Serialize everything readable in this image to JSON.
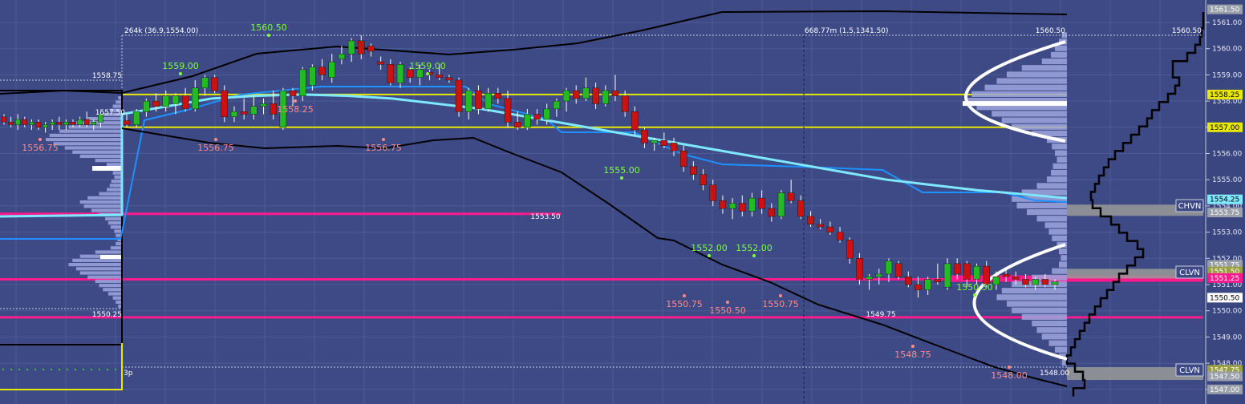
{
  "chart_data": {
    "type": "candlestick",
    "title": "",
    "xlabel": "",
    "ylabel": "",
    "ylim": [
      1547.0,
      1561.5
    ],
    "grid": true,
    "axis_ticks": [
      "1561.00",
      "1560.00",
      "1559.00",
      "1558.00",
      "1557.00",
      "1556.00",
      "1555.00",
      "1554.00",
      "1553.00",
      "1552.00",
      "1551.00",
      "1550.00",
      "1549.00",
      "1548.00",
      "1547.00"
    ],
    "header_labels": {
      "left": "264k (36.9,1554.00)",
      "middle": "668.77m (1.5,1341.50)",
      "right_high": "1560.50",
      "far_right_high": "1560.50",
      "prev_high": "1558.75",
      "prev_low": "1550.25",
      "prev_mid": "1557.50",
      "bottom_left": "3p",
      "session_low": "1548.00"
    },
    "axis_badges": [
      {
        "label": "1561.50",
        "value": 1561.5,
        "color": "#9aa0aa"
      },
      {
        "label": "1558.25",
        "value": 1558.25,
        "color": "#e8e800"
      },
      {
        "label": "1557.00",
        "value": 1557.0,
        "color": "#e8e800"
      },
      {
        "label": "1554.25",
        "value": 1554.25,
        "color": "#7ee8ff"
      },
      {
        "label": "1553.75",
        "value": 1553.75,
        "color": "#9aa0aa"
      },
      {
        "label": "1551.75",
        "value": 1551.75,
        "color": "#9aa0aa"
      },
      {
        "label": "1551.50",
        "value": 1551.5,
        "color": "#9aa040"
      },
      {
        "label": "1551.25",
        "value": 1551.25,
        "color": "#ff1a8c"
      },
      {
        "label": "1550.50",
        "value": 1550.5,
        "color": "#ffffff"
      },
      {
        "label": "1547.75",
        "value": 1547.75,
        "color": "#9aa040"
      },
      {
        "label": "1547.50",
        "value": 1547.5,
        "color": "#9aa0aa"
      },
      {
        "label": "1547.00",
        "value": 1547.0,
        "color": "#9aa0aa"
      }
    ],
    "level_tags": [
      {
        "label": "CHVN",
        "value": 1554.0
      },
      {
        "label": "CLVN",
        "value": 1551.25
      },
      {
        "label": "CLVN",
        "value": 1547.5
      }
    ],
    "horizontal_lines": [
      {
        "value": 1558.25,
        "color": "#e8e800"
      },
      {
        "value": 1557.0,
        "color": "#e8e800"
      },
      {
        "value": 1553.7,
        "color": "#ff1a8c"
      },
      {
        "value": 1551.2,
        "color": "#ff1a8c"
      },
      {
        "value": 1549.75,
        "color": "#ff1a8c"
      }
    ],
    "swing_highs": [
      {
        "label": "1560.50",
        "bar": 19
      },
      {
        "label": "1559.00",
        "bar": 13
      },
      {
        "label": "1559.00",
        "bar": 33
      },
      {
        "label": "1555.00",
        "bar": 47
      },
      {
        "label": "1552.00",
        "bar": 55
      },
      {
        "label": "1552.00",
        "bar": 59
      },
      {
        "label": "1550.50",
        "bar": 76
      }
    ],
    "swing_lows": [
      {
        "label": "1556.75",
        "bar": -5
      },
      {
        "label": "1558.25",
        "bar": 22
      },
      {
        "label": "1556.75",
        "bar": 16
      },
      {
        "label": "1556.75",
        "bar": 29
      },
      {
        "label": "1553.50",
        "bar": 43
      },
      {
        "label": "1550.75",
        "bar": 53
      },
      {
        "label": "1550.50",
        "bar": 57
      },
      {
        "label": "1550.75",
        "bar": 61
      },
      {
        "label": "1549.75",
        "bar": 69
      },
      {
        "label": "1548.75",
        "bar": 71
      },
      {
        "label": "1548.00",
        "bar": 79
      }
    ],
    "candles_prev": [
      [
        1557.4,
        1557.5,
        1557.1,
        1557.2
      ],
      [
        1557.2,
        1557.4,
        1557.0,
        1557.1
      ],
      [
        1557.1,
        1557.5,
        1556.9,
        1557.3
      ],
      [
        1557.3,
        1557.4,
        1557.0,
        1557.1
      ],
      [
        1557.1,
        1557.3,
        1556.9,
        1557.2
      ],
      [
        1557.2,
        1557.3,
        1556.9,
        1557.0
      ],
      [
        1557.0,
        1557.2,
        1556.8,
        1557.1
      ],
      [
        1557.1,
        1557.3,
        1556.9,
        1557.2
      ],
      [
        1557.2,
        1557.4,
        1556.9,
        1557.1
      ],
      [
        1557.1,
        1557.3,
        1556.9,
        1557.2
      ],
      [
        1557.2,
        1557.3,
        1557.0,
        1557.1
      ],
      [
        1557.1,
        1557.4,
        1557.0,
        1557.3
      ],
      [
        1557.3,
        1557.6,
        1557.0,
        1557.1
      ],
      [
        1557.1,
        1557.3,
        1556.9,
        1557.2
      ],
      [
        1557.2,
        1557.6,
        1557.0,
        1557.5
      ]
    ],
    "candles": [
      [
        1557.25,
        1557.5,
        1557.0,
        1557.1
      ],
      [
        1557.1,
        1557.7,
        1557.0,
        1557.6
      ],
      [
        1557.6,
        1558.1,
        1557.4,
        1558.0
      ],
      [
        1558.0,
        1558.3,
        1557.6,
        1557.8
      ],
      [
        1557.8,
        1558.4,
        1557.6,
        1558.2
      ],
      [
        1557.9,
        1558.3,
        1557.5,
        1558.2
      ],
      [
        1558.2,
        1558.5,
        1557.6,
        1557.7
      ],
      [
        1557.7,
        1558.8,
        1557.6,
        1558.5
      ],
      [
        1558.5,
        1559.0,
        1558.2,
        1558.9
      ],
      [
        1558.9,
        1559.0,
        1558.3,
        1558.4
      ],
      [
        1558.4,
        1558.6,
        1557.2,
        1557.4
      ],
      [
        1557.4,
        1557.8,
        1557.2,
        1557.6
      ],
      [
        1557.6,
        1558.1,
        1557.3,
        1557.5
      ],
      [
        1557.5,
        1558.2,
        1557.3,
        1557.8
      ],
      [
        1557.8,
        1558.1,
        1557.5,
        1557.9
      ],
      [
        1557.9,
        1558.4,
        1557.3,
        1557.5
      ],
      [
        1557.0,
        1558.5,
        1556.9,
        1558.4
      ],
      [
        1558.4,
        1558.5,
        1557.8,
        1558.2
      ],
      [
        1558.2,
        1559.3,
        1558.0,
        1559.2
      ],
      [
        1558.6,
        1559.4,
        1558.4,
        1559.3
      ],
      [
        1559.3,
        1559.6,
        1558.8,
        1559.0
      ],
      [
        1558.9,
        1559.8,
        1558.7,
        1559.5
      ],
      [
        1559.6,
        1560.1,
        1559.4,
        1559.8
      ],
      [
        1559.8,
        1560.4,
        1559.5,
        1560.3
      ],
      [
        1560.3,
        1560.5,
        1559.6,
        1559.8
      ],
      [
        1560.1,
        1560.2,
        1559.7,
        1559.9
      ],
      [
        1559.5,
        1559.7,
        1559.2,
        1559.4
      ],
      [
        1559.4,
        1559.6,
        1558.6,
        1558.7
      ],
      [
        1558.7,
        1559.5,
        1558.5,
        1559.4
      ],
      [
        1559.2,
        1559.3,
        1558.7,
        1558.9
      ],
      [
        1558.9,
        1559.4,
        1558.6,
        1559.2
      ],
      [
        1559.1,
        1559.2,
        1558.8,
        1559.0
      ],
      [
        1559.0,
        1559.4,
        1558.8,
        1558.9
      ],
      [
        1558.9,
        1559.0,
        1558.7,
        1558.8
      ],
      [
        1558.8,
        1558.9,
        1557.4,
        1557.6
      ],
      [
        1557.6,
        1558.5,
        1557.3,
        1558.4
      ],
      [
        1558.4,
        1558.6,
        1557.5,
        1557.7
      ],
      [
        1557.7,
        1558.5,
        1557.6,
        1558.3
      ],
      [
        1558.3,
        1558.5,
        1557.9,
        1558.1
      ],
      [
        1558.1,
        1558.4,
        1557.0,
        1557.2
      ],
      [
        1557.2,
        1557.6,
        1556.9,
        1557.0
      ],
      [
        1557.0,
        1557.7,
        1556.9,
        1557.5
      ],
      [
        1557.5,
        1557.7,
        1557.1,
        1557.3
      ],
      [
        1557.3,
        1557.9,
        1557.1,
        1557.7
      ],
      [
        1557.7,
        1558.1,
        1557.4,
        1558.0
      ],
      [
        1558.0,
        1558.5,
        1557.6,
        1558.4
      ],
      [
        1558.4,
        1558.6,
        1557.9,
        1558.1
      ],
      [
        1558.1,
        1558.9,
        1558.0,
        1558.5
      ],
      [
        1558.5,
        1558.7,
        1557.7,
        1557.9
      ],
      [
        1557.9,
        1558.6,
        1557.8,
        1558.4
      ],
      [
        1558.4,
        1559.0,
        1558.0,
        1558.2
      ],
      [
        1558.2,
        1558.4,
        1557.4,
        1557.6
      ],
      [
        1557.6,
        1557.8,
        1556.7,
        1556.9
      ],
      [
        1556.9,
        1557.0,
        1556.2,
        1556.4
      ],
      [
        1556.4,
        1556.6,
        1556.1,
        1556.5
      ],
      [
        1556.5,
        1556.8,
        1556.2,
        1556.3
      ],
      [
        1556.4,
        1556.6,
        1555.9,
        1556.1
      ],
      [
        1556.1,
        1556.3,
        1555.3,
        1555.5
      ],
      [
        1555.5,
        1555.7,
        1555.0,
        1555.2
      ],
      [
        1555.2,
        1555.4,
        1554.6,
        1554.8
      ],
      [
        1554.8,
        1555.0,
        1554.0,
        1554.2
      ],
      [
        1554.2,
        1554.4,
        1553.7,
        1553.9
      ],
      [
        1553.9,
        1554.3,
        1553.5,
        1554.1
      ],
      [
        1554.1,
        1554.4,
        1553.6,
        1553.8
      ],
      [
        1553.8,
        1554.5,
        1553.6,
        1554.3
      ],
      [
        1554.3,
        1554.6,
        1553.7,
        1553.9
      ],
      [
        1553.9,
        1554.1,
        1553.4,
        1553.6
      ],
      [
        1553.6,
        1554.6,
        1553.5,
        1554.5
      ],
      [
        1554.5,
        1555.0,
        1554.1,
        1554.2
      ],
      [
        1554.2,
        1554.4,
        1553.5,
        1553.6
      ],
      [
        1553.6,
        1553.8,
        1553.2,
        1553.3
      ],
      [
        1553.3,
        1553.5,
        1553.1,
        1553.2
      ],
      [
        1553.2,
        1553.4,
        1552.9,
        1553.0
      ],
      [
        1553.0,
        1553.2,
        1552.6,
        1552.7
      ],
      [
        1552.7,
        1552.8,
        1551.8,
        1552.0
      ],
      [
        1552.0,
        1552.2,
        1551.0,
        1551.2
      ],
      [
        1551.2,
        1551.4,
        1550.8,
        1551.3
      ],
      [
        1551.3,
        1551.6,
        1551.0,
        1551.4
      ],
      [
        1551.4,
        1552.0,
        1551.1,
        1551.9
      ],
      [
        1551.8,
        1551.9,
        1551.2,
        1551.3
      ],
      [
        1551.3,
        1551.5,
        1550.9,
        1551.0
      ],
      [
        1551.0,
        1551.3,
        1550.5,
        1550.8
      ],
      [
        1550.8,
        1551.3,
        1550.6,
        1551.2
      ],
      [
        1551.2,
        1551.8,
        1551.0,
        1551.1
      ],
      [
        1550.9,
        1552.0,
        1550.8,
        1551.8
      ],
      [
        1551.8,
        1552.0,
        1551.2,
        1551.4
      ],
      [
        1551.8,
        1551.9,
        1550.9,
        1551.2
      ],
      [
        1551.2,
        1551.8,
        1551.0,
        1551.7
      ],
      [
        1551.7,
        1551.9,
        1550.9,
        1551.0
      ],
      [
        1551.0,
        1551.5,
        1550.8,
        1551.3
      ],
      [
        1551.4,
        1551.6,
        1551.1,
        1551.3
      ],
      [
        1551.3,
        1551.5,
        1551.0,
        1551.2
      ],
      [
        1551.2,
        1551.4,
        1550.9,
        1551.0
      ],
      [
        1551.0,
        1551.3,
        1550.8,
        1551.2
      ],
      [
        1551.2,
        1551.4,
        1550.9,
        1551.0
      ],
      [
        1551.0,
        1551.2,
        1550.8,
        1551.1
      ]
    ],
    "bar_count": 96,
    "vwap": [
      1557.5,
      1557.8,
      1558.1,
      1558.2,
      1558.25,
      1558.2,
      1558.1,
      1557.9,
      1557.7,
      1557.4,
      1557.1,
      1556.8,
      1556.5,
      1556.2,
      1555.9,
      1555.6,
      1555.3,
      1555.0,
      1554.8,
      1554.6,
      1554.45,
      1554.3
    ],
    "volume_profile_session": [
      {
        "price": 1560.5,
        "v": 0.05
      },
      {
        "price": 1560.25,
        "v": 0.08
      },
      {
        "price": 1560.0,
        "v": 0.12
      },
      {
        "price": 1559.75,
        "v": 0.16
      },
      {
        "price": 1559.5,
        "v": 0.25
      },
      {
        "price": 1559.25,
        "v": 0.45
      },
      {
        "price": 1559.0,
        "v": 0.6
      },
      {
        "price": 1558.75,
        "v": 0.7
      },
      {
        "price": 1558.5,
        "v": 0.82
      },
      {
        "price": 1558.25,
        "v": 0.95
      },
      {
        "price": 1558.0,
        "v": 1.0
      },
      {
        "price": 1557.75,
        "v": 0.9
      },
      {
        "price": 1557.5,
        "v": 0.75
      },
      {
        "price": 1557.25,
        "v": 0.65
      },
      {
        "price": 1557.0,
        "v": 0.55
      },
      {
        "price": 1556.75,
        "v": 0.35
      },
      {
        "price": 1556.5,
        "v": 0.2
      },
      {
        "price": 1556.25,
        "v": 0.15
      },
      {
        "price": 1556.0,
        "v": 0.12
      },
      {
        "price": 1555.75,
        "v": 0.1
      },
      {
        "price": 1555.5,
        "v": 0.14
      },
      {
        "price": 1555.25,
        "v": 0.16
      },
      {
        "price": 1555.0,
        "v": 0.2
      },
      {
        "price": 1554.75,
        "v": 0.3
      },
      {
        "price": 1554.5,
        "v": 0.45
      },
      {
        "price": 1554.25,
        "v": 0.55
      },
      {
        "price": 1554.0,
        "v": 0.5
      },
      {
        "price": 1553.75,
        "v": 0.4
      },
      {
        "price": 1553.5,
        "v": 0.3
      },
      {
        "price": 1553.25,
        "v": 0.22
      },
      {
        "price": 1553.0,
        "v": 0.18
      },
      {
        "price": 1552.75,
        "v": 0.15
      },
      {
        "price": 1552.5,
        "v": 0.1
      },
      {
        "price": 1552.25,
        "v": 0.08
      },
      {
        "price": 1552.0,
        "v": 0.06
      },
      {
        "price": 1551.75,
        "v": 0.08
      },
      {
        "price": 1551.5,
        "v": 0.15
      },
      {
        "price": 1551.25,
        "v": 0.35
      },
      {
        "price": 1551.0,
        "v": 0.55
      },
      {
        "price": 1550.75,
        "v": 0.65
      },
      {
        "price": 1550.5,
        "v": 0.7
      },
      {
        "price": 1550.25,
        "v": 0.6
      },
      {
        "price": 1550.0,
        "v": 0.55
      },
      {
        "price": 1549.75,
        "v": 0.45
      },
      {
        "price": 1549.5,
        "v": 0.35
      },
      {
        "price": 1549.25,
        "v": 0.3
      },
      {
        "price": 1549.0,
        "v": 0.25
      },
      {
        "price": 1548.75,
        "v": 0.18
      },
      {
        "price": 1548.5,
        "v": 0.12
      },
      {
        "price": 1548.25,
        "v": 0.08
      },
      {
        "price": 1548.0,
        "v": 0.05
      }
    ]
  }
}
